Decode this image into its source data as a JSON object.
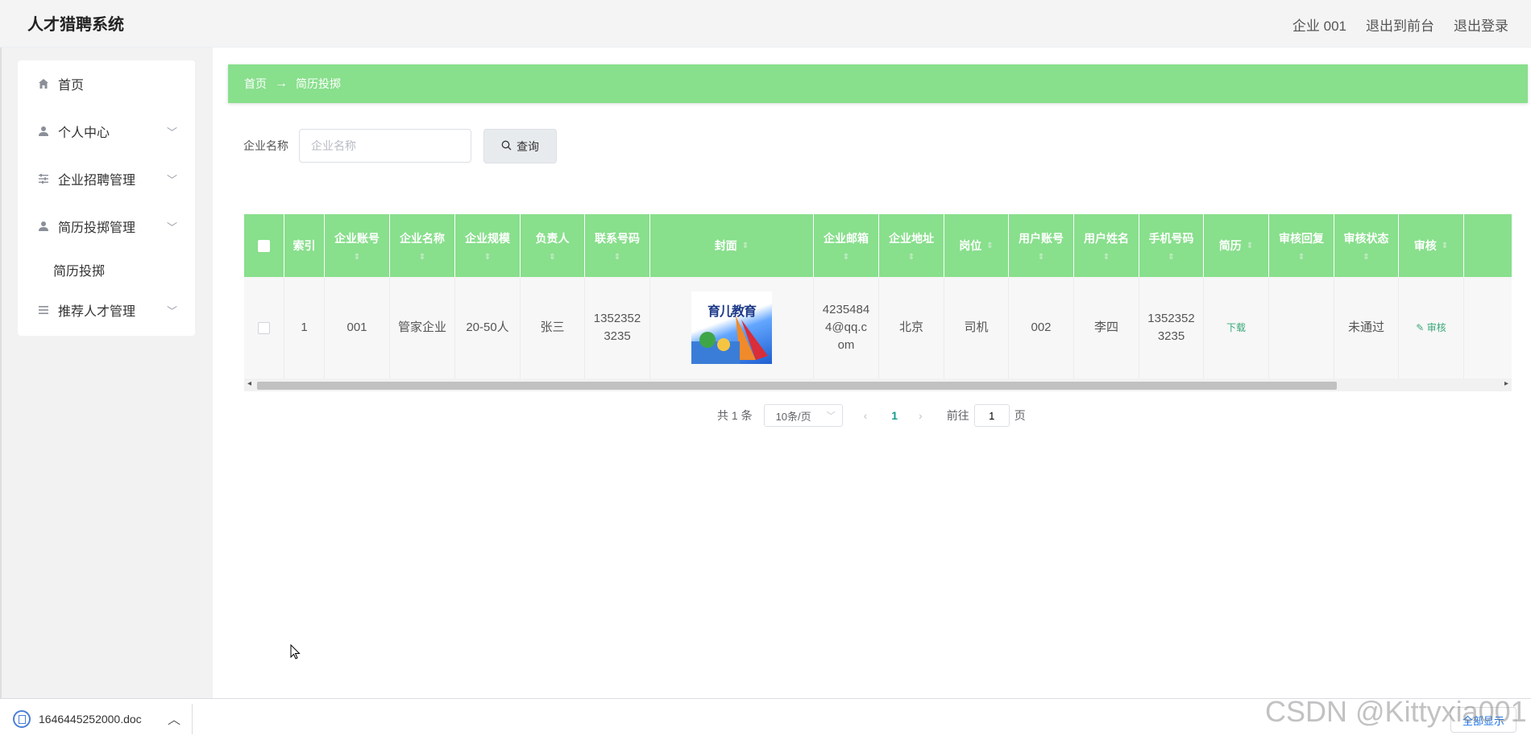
{
  "header": {
    "title": "人才猎聘系统",
    "user": "企业 001",
    "back_to_front": "退出到前台",
    "logout": "退出登录"
  },
  "sidebar": {
    "items": [
      {
        "label": "首页",
        "icon": "home-icon"
      },
      {
        "label": "个人中心",
        "icon": "user-icon"
      },
      {
        "label": "企业招聘管理",
        "icon": "sliders-icon"
      },
      {
        "label": "简历投掷管理",
        "icon": "user-icon"
      },
      {
        "label": "推荐人才管理",
        "icon": "list-icon"
      }
    ],
    "submenu_label": "简历投掷"
  },
  "breadcrumb": {
    "home": "首页",
    "arrow": "→",
    "current": "简历投掷"
  },
  "search": {
    "label": "企业名称",
    "placeholder": "企业名称",
    "button": "查询"
  },
  "table": {
    "columns": [
      "索引",
      "企业账号",
      "企业名称",
      "企业规模",
      "负责人",
      "联系号码",
      "封面",
      "企业邮箱",
      "企业地址",
      "岗位",
      "用户账号",
      "用户姓名",
      "手机号码",
      "简历",
      "审核回复",
      "审核状态",
      "审核"
    ],
    "sort_glyph": "⇕",
    "rows": [
      {
        "index": "1",
        "company_account": "001",
        "company_name": "管家企业",
        "company_size": "20-50人",
        "manager": "张三",
        "phone": "13523523235",
        "cover_text": "育儿教育",
        "email": "42354844@qq.com",
        "address": "北京",
        "position": "司机",
        "user_account": "002",
        "user_name": "李四",
        "mobile": "13523523235",
        "resume_action": "下载",
        "review_reply": "",
        "review_status": "未通过",
        "review_action": "审核"
      }
    ]
  },
  "pagination": {
    "total": "共 1 条",
    "page_size": "10条/页",
    "current_page": "1",
    "goto_label": "前往",
    "goto_value": "1",
    "page_unit": "页"
  },
  "download_bar": {
    "file_name": "1646445252000.doc",
    "show_all": "全部显示"
  },
  "watermark": "CSDN @Kittyxia001",
  "colors": {
    "accent": "#88df8c",
    "link": "#3aa87a",
    "page_active": "#159a8f"
  }
}
